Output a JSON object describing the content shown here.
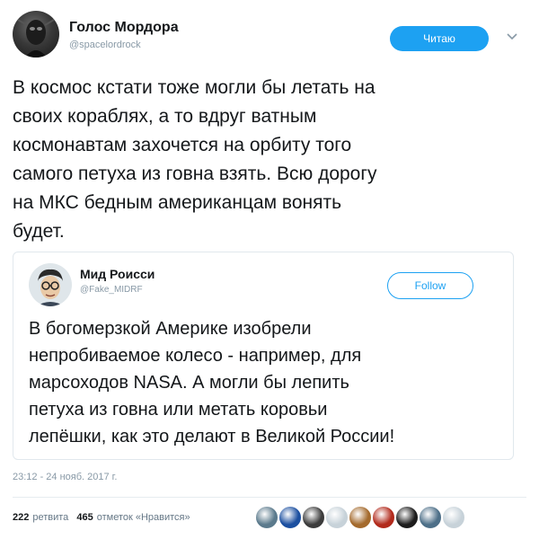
{
  "tweet": {
    "author": {
      "name": "Голос Мордора",
      "handle": "@spacelordrock"
    },
    "follow_button": "Читаю",
    "text_lines": [
      "В космос кстати тоже могли бы летать на",
      "своих кораблях, а то вдруг ватным",
      "космонавтам захочется на орбиту того",
      "самого петуха из говна взять. Всю дорогу",
      "на МКС бедным американцам вонять",
      "будет."
    ],
    "timestamp": "23:12 - 24 нояб. 2017 г.",
    "stats": {
      "retweets_count": "222",
      "retweets_label": "ретвита",
      "likes_count": "465",
      "likes_label": "отметок «Нравится»"
    },
    "likers": [
      {
        "color": "#5b7a8c"
      },
      {
        "color": "#1b4fa0"
      },
      {
        "color": "#3c3c3c"
      },
      {
        "color": "#c7d2d9"
      },
      {
        "color": "#a46a2d"
      },
      {
        "color": "#b22a1c"
      },
      {
        "color": "#1d1d1d"
      },
      {
        "color": "#4d6f88"
      },
      {
        "color": "#c7d2d9"
      }
    ]
  },
  "quoted_tweet": {
    "author": {
      "name": "Мид Роисси",
      "handle": "@Fake_MIDRF"
    },
    "follow_button": "Follow",
    "text_lines": [
      "В богомерзкой Америке изобрели",
      "непробиваемое колесо - например, для",
      "марсоходов NASA. А могли бы лепить",
      "петуха из говна или метать коровьи",
      "лепёшки, как это делают в Великой России!"
    ]
  }
}
